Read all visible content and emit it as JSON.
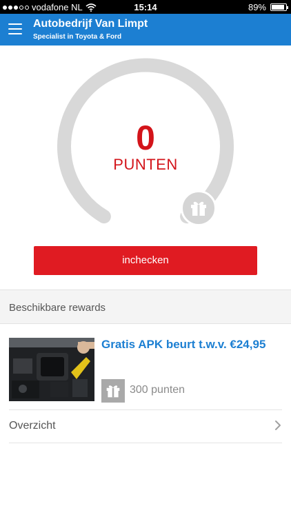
{
  "status_bar": {
    "carrier": "vodafone NL",
    "time": "15:14",
    "battery": "89%",
    "battery_level": 0.89
  },
  "header": {
    "title": "Autobedrijf Van Limpt",
    "subtitle": "Specialist in Toyota & Ford",
    "menu_icon": "hamburger-menu-icon",
    "color": "#1c7fd2"
  },
  "points": {
    "value": "0",
    "label": "PUNTEN",
    "color": "#d3141a",
    "gift_icon": "gift-icon"
  },
  "checkin": {
    "label": "inchecken",
    "color": "#e01b22"
  },
  "rewards": {
    "section_title": "Beschikbare rewards",
    "items": [
      {
        "title": "Gratis APK beurt t.w.v. €24,95",
        "points": "300 punten",
        "icon": "gift-icon"
      }
    ]
  },
  "overview": {
    "label": "Overzicht",
    "icon": "chevron-right-icon"
  }
}
